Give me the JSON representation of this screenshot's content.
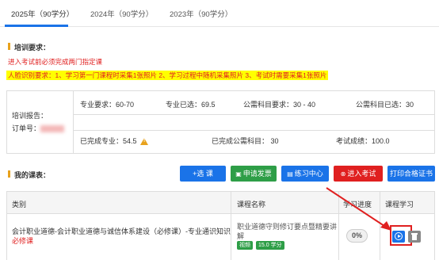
{
  "tabs": [
    {
      "label": "2025年（90学分）"
    },
    {
      "label": "2024年（90学分）"
    },
    {
      "label": "2023年（90学分）"
    }
  ],
  "training": {
    "title": "培训要求：",
    "note_red": "进入考试前必须完成两门指定课",
    "note_face": "人脸识别要求：1、学习第一门课程时采集1张照片 2、学习过程中随机采集照片 3、考试时需要采集1张照片"
  },
  "report": {
    "label": "培训报告：",
    "order_label": "订单号：",
    "major_required": "专业要求：60-70",
    "major_selected": "专业已选：69.5",
    "public_required": "公需科目要求：30 - 40",
    "public_selected": "公需科目已选：30",
    "major_done_label": "已完成专业：",
    "major_done_value": "54.5",
    "public_done": "已完成公需科目：  30",
    "exam_score": "考试成绩：100.0"
  },
  "courses": {
    "title": "我的课表：",
    "buttons": {
      "select": "+选  课",
      "invoice": "申请发票",
      "practice": "练习中心",
      "exam": "进入考试",
      "certificate": "打印合格证书"
    },
    "columns": [
      "类别",
      "课程名称",
      "学习进度",
      "课程学习"
    ],
    "rows": [
      {
        "category_line1": "会计职业道德-会计职业道德与诚信体系建设（必修课）-专业通识知识",
        "category_line2": "必修课",
        "name_line1": "职业道德守则修订要点暨精要讲",
        "name_line2": "解",
        "tag_type": "视频",
        "tag_credit": "15.0 学分",
        "progress": "0%"
      }
    ]
  },
  "colors": {
    "primary": "#1a73e8",
    "green": "#2e9e47",
    "red": "#e02020",
    "highlight_yellow": "#ffff00"
  }
}
